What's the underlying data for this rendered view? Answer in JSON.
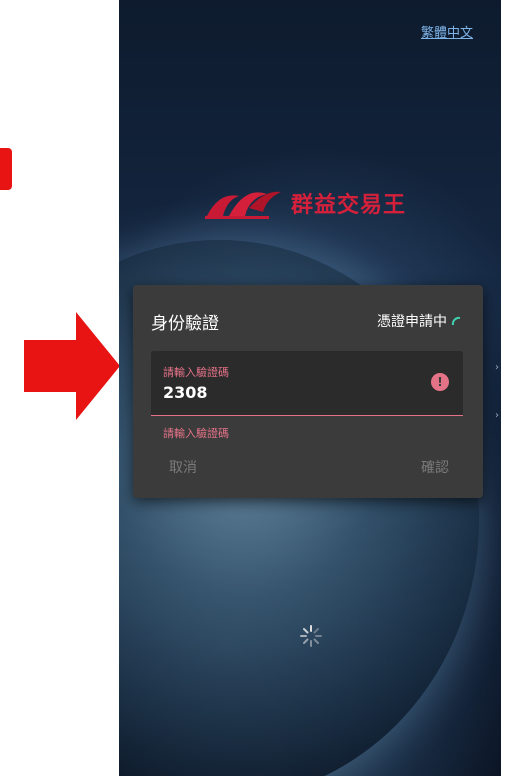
{
  "language_link": "繁體中文",
  "brand": {
    "name": "群益交易王"
  },
  "dialog": {
    "title": "身份驗證",
    "status": "憑證申請中",
    "field_label": "請輸入驗證碼",
    "field_value": "2308",
    "helper_text": "請輸入驗證碼",
    "cancel_label": "取消",
    "confirm_label": "確認"
  },
  "colors": {
    "brand_red": "#d4203b",
    "error_pink": "#e57388",
    "dialog_bg": "#3b3b3b",
    "arrow_red": "#e81414"
  },
  "icons": [
    "arrow-right-icon",
    "error-icon",
    "spinner-icon",
    "loading-icon"
  ]
}
